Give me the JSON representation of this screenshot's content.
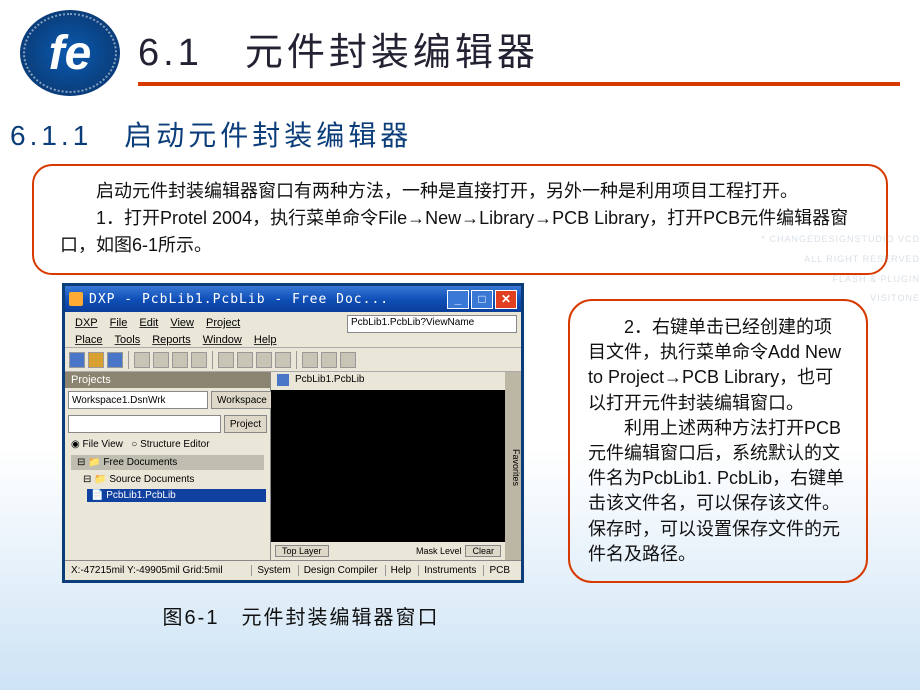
{
  "header": {
    "logo_text": "fe",
    "title": "6.1　元件封装编辑器"
  },
  "subtitle": "6.1.1　启动元件封装编辑器",
  "box1": {
    "p1": "启动元件封装编辑器窗口有两种方法，一种是直接打开，另外一种是利用项目工程打开。",
    "p2": "1．打开Protel 2004，执行菜单命令File→New→Library→PCB Library，打开PCB元件编辑器窗口，如图6-1所示。"
  },
  "screenshot": {
    "win_title": "DXP - PcbLib1.PcbLib - Free Doc...",
    "menu": {
      "row1": [
        "DXP",
        "File",
        "Edit",
        "View",
        "Project"
      ],
      "row2": [
        "Place",
        "Tools",
        "Reports",
        "Window",
        "Help"
      ],
      "pcb_box": "PcbLib1.PcbLib?ViewName"
    },
    "projects": {
      "header": "Projects",
      "workspace_value": "Workspace1.DsnWrk",
      "workspace_btn": "Workspace",
      "project_btn": "Project",
      "radio_file": "File View",
      "radio_struct": "Structure Editor",
      "free_docs": "Free Documents",
      "source_docs": "Source Documents",
      "pcb_file": "PcbLib1.PcbLib"
    },
    "crumb": "PcbLib1.PcbLib",
    "favorites": "Favorites",
    "bottom": {
      "top_layer": "Top Layer",
      "mask": "Mask Level",
      "clear": "Clear"
    },
    "status": {
      "coord": "X:-47215mil Y:-49905mil   Grid:5mil",
      "items": [
        "System",
        "Design Compiler",
        "Help",
        "Instruments",
        "PCB"
      ]
    }
  },
  "caption": "图6-1　元件封装编辑器窗口",
  "box2": {
    "p1": "2．右键单击已经创建的项目文件，执行菜单命令Add New to Project→PCB Library，也可以打开元件封装编辑窗口。",
    "p2": "利用上述两种方法打开PCB元件编辑窗口后，系统默认的文件名为PcbLib1. PcbLib，右键单击该文件名，可以保存该文件。保存时，可以设置保存文件的元件名及路径。"
  },
  "watermark": {
    "l1": "* CHANGEDESIGNSTUDIO VCD",
    "l2": "ALL RIGHT RESERVED",
    "l3": "FLASH & PLUGIN",
    "l4": "VISITONE"
  }
}
